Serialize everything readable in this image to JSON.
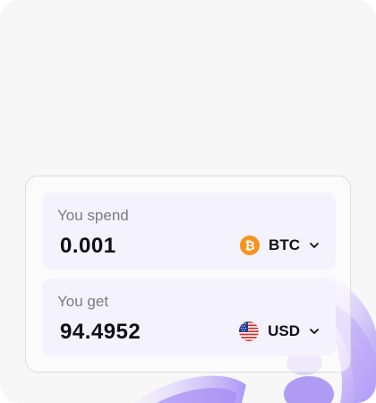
{
  "spend": {
    "label": "You spend",
    "amount": "0.001",
    "currency": "BTC",
    "icon": "bitcoin-icon",
    "icon_color": "#f7931a",
    "icon_glyph": "₿"
  },
  "get": {
    "label": "You get",
    "amount": "94.4952",
    "currency": "USD",
    "icon": "us-flag-icon"
  },
  "colors": {
    "box_background": "#f3f2fd",
    "accent_purple": "#8b6ff2"
  }
}
